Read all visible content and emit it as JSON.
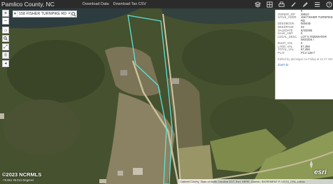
{
  "app": {
    "title": "Pamlico County, NC",
    "links": [
      "Download Data",
      "Download Tax CSV"
    ]
  },
  "toolbar": {
    "icons": [
      "layers-icon",
      "basemap-icon",
      "print-icon",
      "measure-icon",
      "draw-icon",
      "list-icon",
      "help-icon"
    ]
  },
  "search": {
    "value": "158 FISHER TURNPIKE RD",
    "clear_glyph": "×"
  },
  "controls": {
    "zoom_in": "+",
    "zoom_out": "−",
    "home": "⌂",
    "extent": "⤢",
    "location": "◎",
    "back": "◂",
    "forward": "▸"
  },
  "popup": {
    "rows": [
      {
        "k": "",
        "v": "5"
      },
      {
        "k": "OWNER_ZIP",
        "v": "28510"
      },
      {
        "k": "SITUS_ADDR",
        "v": "158 FISHER TURNPIKE RD"
      },
      {
        "k": "DEEDBOOK",
        "v": "000445"
      },
      {
        "k": "DEEDPAGE",
        "v": "44"
      },
      {
        "k": "SALEDATE",
        "v": "5/4/2005"
      },
      {
        "k": "SALE_AMT",
        "v": "0"
      },
      {
        "k": "LEGAL_DESC",
        "v": "LOT 5 TIDEWATER WOODS I"
      },
      {
        "k": "BLDG_VAL",
        "v": "0"
      },
      {
        "k": "LAND_VAL",
        "v": "67,458"
      },
      {
        "k": "TOTAL_VAL",
        "v": "67,458"
      },
      {
        "k": "PLAT",
        "v": "PCA 128-7"
      }
    ],
    "edited": "Edited by tpennigar on Friday at 11:27 AM",
    "zoom_to": "Zoom to"
  },
  "footer": {
    "logo": "©2023 NCRMLS",
    "coords": "-76.851 35.041 Degrees",
    "attribution": "Carteret County, State of North Carolina DOT, Esri, HERE, Garmin, INCREMENT P, USGS, EPA, USDA",
    "esri": "esri"
  }
}
